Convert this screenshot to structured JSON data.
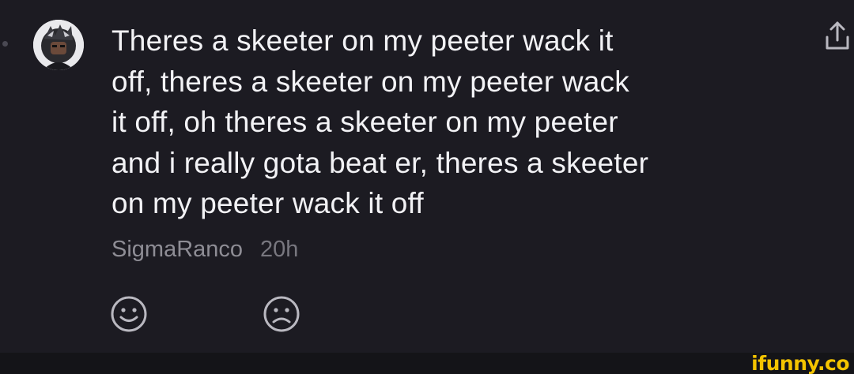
{
  "comment": {
    "text_lines": [
      "Theres a skeeter on my peeter wack it",
      "off, theres a skeeter on my peeter wack",
      "it off, oh theres a skeeter on my peeter",
      "and i really gota beat er, theres a skeeter",
      "on my peeter wack it off"
    ],
    "author": "SigmaRanco",
    "time": "20h"
  },
  "icons": {
    "share": "share-icon",
    "like": "smile-icon",
    "dislike": "frown-icon",
    "avatar": "avatar"
  },
  "colors": {
    "background": "#1c1b22",
    "text": "#f2f2f5",
    "meta": "#8e8d95",
    "icon": "#b9b8c0",
    "watermark": "#f4c400"
  },
  "watermark": "ifunny.co"
}
